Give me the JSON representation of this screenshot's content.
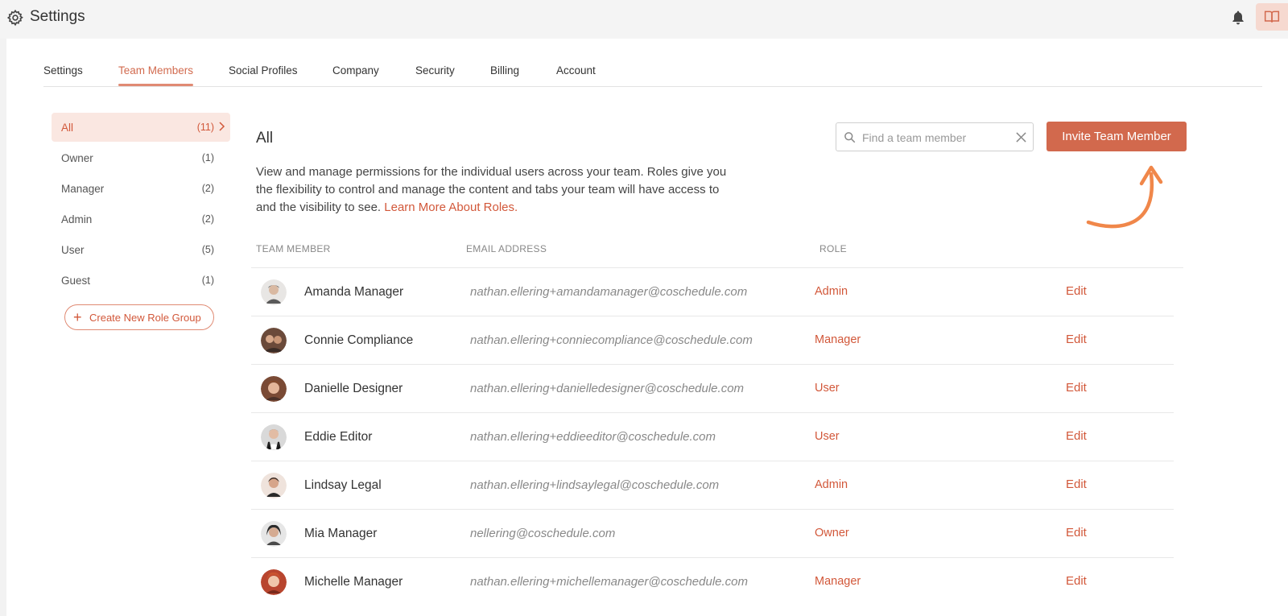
{
  "header": {
    "title": "Settings",
    "icons": {
      "settings": "gear-icon",
      "notifications": "bell-icon",
      "docs": "book-icon"
    }
  },
  "tabs": [
    {
      "label": "Settings"
    },
    {
      "label": "Team Members",
      "active": true
    },
    {
      "label": "Social Profiles"
    },
    {
      "label": "Company"
    },
    {
      "label": "Security"
    },
    {
      "label": "Billing"
    },
    {
      "label": "Account"
    }
  ],
  "sidebar": {
    "items": [
      {
        "label": "All",
        "count": "(11)",
        "active": true
      },
      {
        "label": "Owner",
        "count": "(1)"
      },
      {
        "label": "Manager",
        "count": "(2)"
      },
      {
        "label": "Admin",
        "count": "(2)"
      },
      {
        "label": "User",
        "count": "(5)"
      },
      {
        "label": "Guest",
        "count": "(1)"
      }
    ],
    "create_button": {
      "icon": "plus-icon",
      "label": "Create New Role Group"
    }
  },
  "main": {
    "title": "All",
    "description": "View and manage permissions for the individual users across your team. Roles give you the flexibility to control and manage the content and tabs your team will have access to and the visibility to see.",
    "learn_more": "Learn More About Roles.",
    "search": {
      "placeholder": "Find a team member",
      "value": ""
    },
    "invite_button": "Invite Team Member",
    "columns": {
      "member": "TEAM MEMBER",
      "email": "EMAIL ADDRESS",
      "role": "ROLE"
    },
    "members": [
      {
        "name": "Amanda Manager",
        "email": "nathan.ellering+amandamanager@coschedule.com",
        "role": "Admin",
        "action": "Edit"
      },
      {
        "name": "Connie Compliance",
        "email": "nathan.ellering+conniecompliance@coschedule.com",
        "role": "Manager",
        "action": "Edit"
      },
      {
        "name": "Danielle Designer",
        "email": "nathan.ellering+danielledesigner@coschedule.com",
        "role": "User",
        "action": "Edit"
      },
      {
        "name": "Eddie Editor",
        "email": "nathan.ellering+eddieeditor@coschedule.com",
        "role": "User",
        "action": "Edit"
      },
      {
        "name": "Lindsay Legal",
        "email": "nathan.ellering+lindsaylegal@coschedule.com",
        "role": "Admin",
        "action": "Edit"
      },
      {
        "name": "Mia Manager",
        "email": "nellering@coschedule.com",
        "role": "Owner",
        "action": "Edit"
      },
      {
        "name": "Michelle Manager",
        "email": "nathan.ellering+michellemanager@coschedule.com",
        "role": "Manager",
        "action": "Edit"
      }
    ]
  },
  "colors": {
    "accent": "#d2694d",
    "accent_light": "#fae7e1",
    "annotation_arrow": "#f0874a"
  }
}
